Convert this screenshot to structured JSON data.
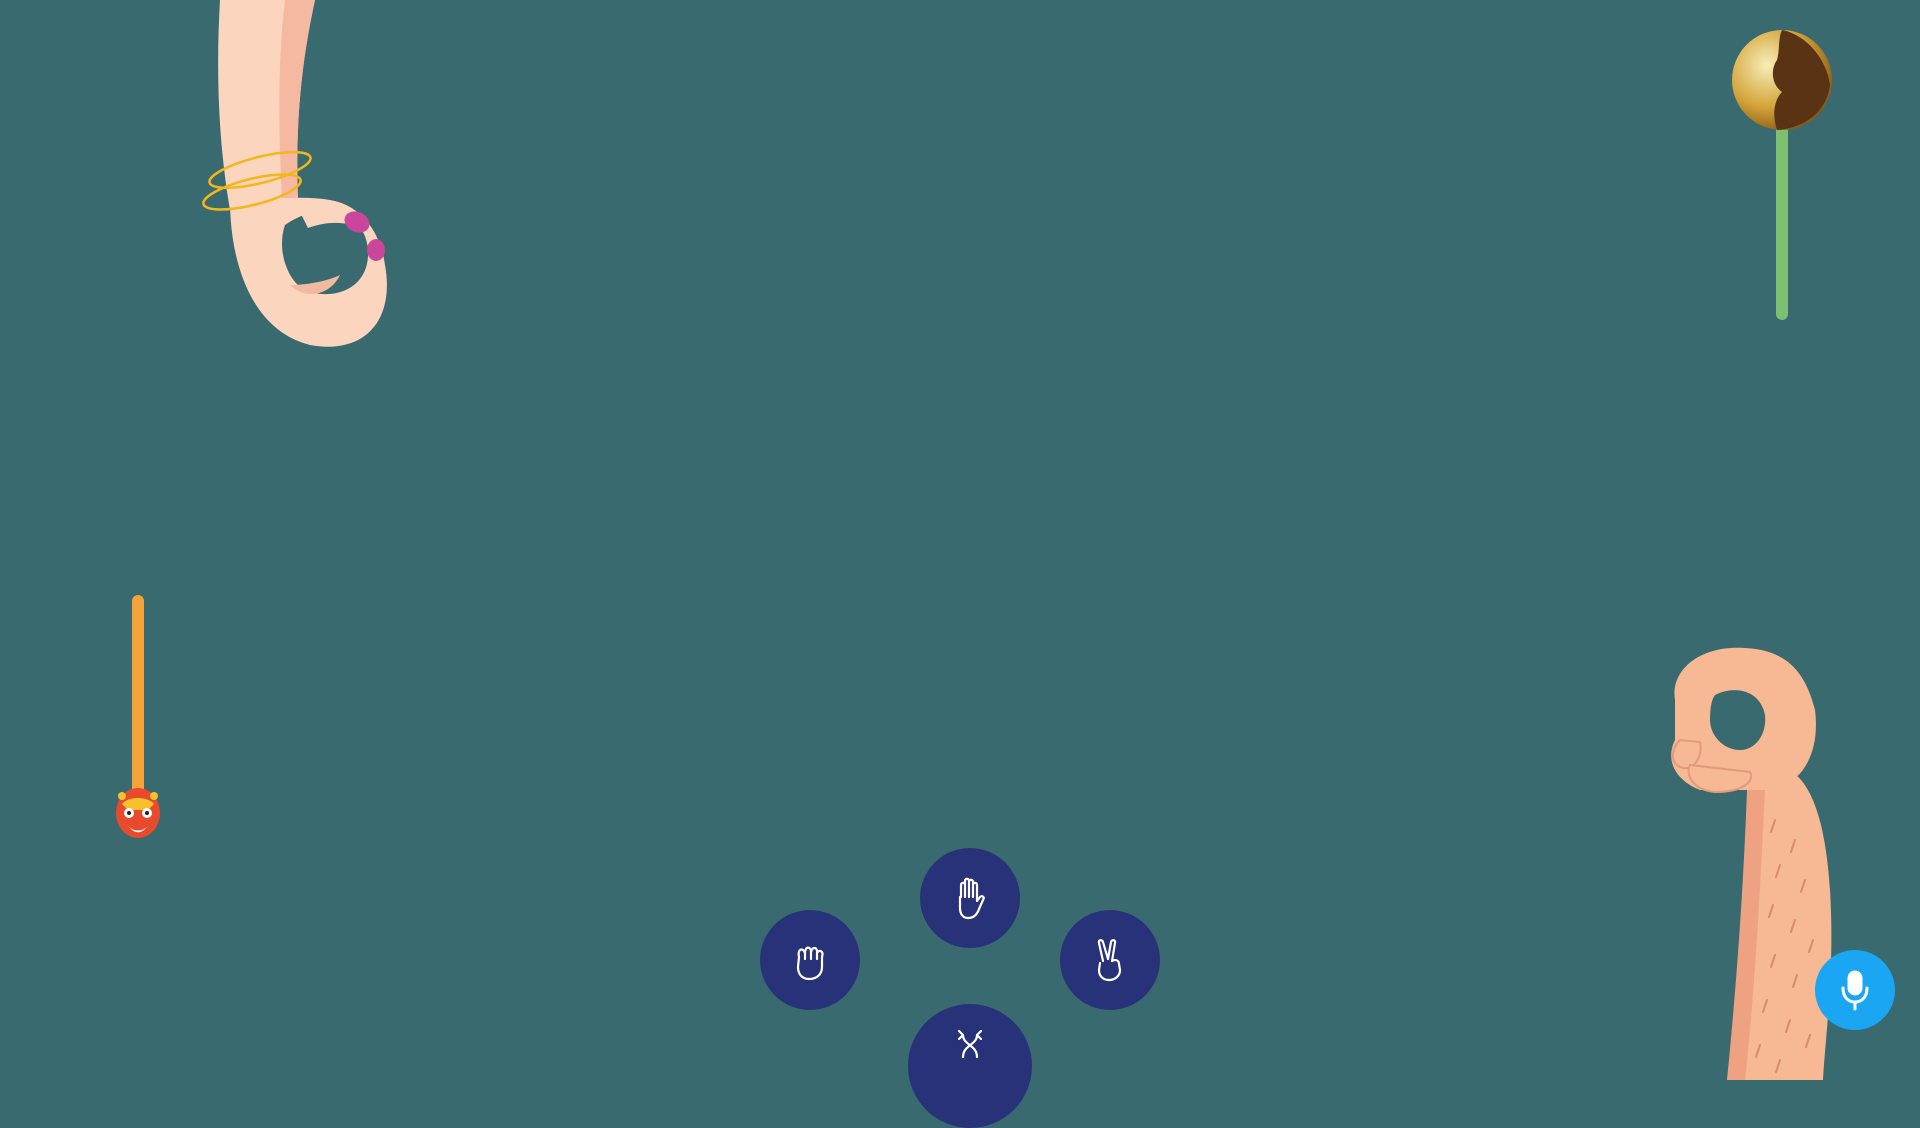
{
  "colors": {
    "background": "#396a70",
    "button": "#283278",
    "mic": "#1aa6f2",
    "opponent_meter": "#7ec072",
    "player_meter": "#f5a43a",
    "skin_light": "#fcd5bf",
    "skin_tan": "#f6b994",
    "nail": "#c9469b",
    "bracelet": "#f2b71b"
  },
  "opponent": {
    "hand": "ok-hand-icon",
    "avatar": "planet-avatar-icon",
    "health": 1.0
  },
  "player": {
    "hand": "ok-hand-icon",
    "avatar": "luchador-mask-icon",
    "health": 1.0
  },
  "controls": {
    "gestures": [
      {
        "name": "rock",
        "icon": "fist-icon"
      },
      {
        "name": "paper",
        "icon": "open-hand-icon"
      },
      {
        "name": "scissors",
        "icon": "victory-hand-icon"
      },
      {
        "name": "random",
        "icon": "shuffle-icon"
      }
    ],
    "voice": "microphone-icon"
  }
}
